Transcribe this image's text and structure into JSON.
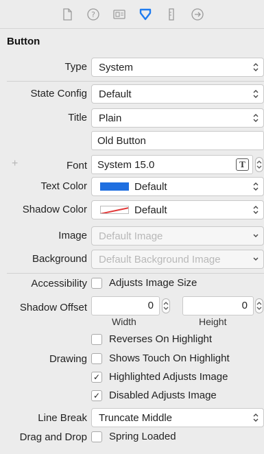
{
  "toolbar": {
    "icons": [
      "file-icon",
      "help-icon",
      "identity-icon",
      "attributes-icon",
      "size-icon",
      "connections-icon"
    ]
  },
  "section": {
    "title": "Button"
  },
  "type": {
    "label": "Type",
    "value": "System"
  },
  "state_config": {
    "label": "State Config",
    "value": "Default"
  },
  "title": {
    "label": "Title",
    "value": "Plain",
    "text": "Old Button"
  },
  "font": {
    "plus": "+",
    "label": "Font",
    "value": "System 15.0",
    "button": "T"
  },
  "text_color": {
    "label": "Text Color",
    "value": "Default",
    "swatch": "#1f6fe0"
  },
  "shadow_color": {
    "label": "Shadow Color",
    "value": "Default"
  },
  "image": {
    "label": "Image",
    "placeholder": "Default Image"
  },
  "background": {
    "label": "Background",
    "placeholder": "Default Background Image"
  },
  "accessibility": {
    "label": "Accessibility",
    "option": "Adjusts Image Size",
    "checked": false
  },
  "shadow_offset": {
    "label": "Shadow Offset",
    "width_value": "0",
    "height_value": "0",
    "width_label": "Width",
    "height_label": "Height"
  },
  "drawing": {
    "label": "Drawing",
    "options": [
      {
        "text": "Reverses On Highlight",
        "checked": false,
        "mark": ""
      },
      {
        "text": "Shows Touch On Highlight",
        "checked": false,
        "mark": ""
      },
      {
        "text": "Highlighted Adjusts Image",
        "checked": true,
        "mark": "✓"
      },
      {
        "text": "Disabled Adjusts Image",
        "checked": true,
        "mark": "✓"
      }
    ]
  },
  "line_break": {
    "label": "Line Break",
    "value": "Truncate Middle"
  },
  "drag_drop": {
    "label": "Drag and Drop",
    "option": "Spring Loaded",
    "checked": false
  }
}
